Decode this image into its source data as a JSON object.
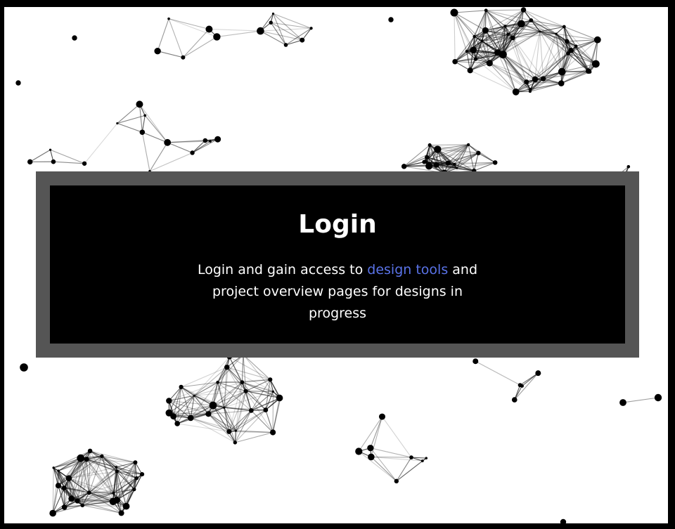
{
  "login": {
    "title": "Login",
    "description_before": "Login and gain access to ",
    "link_text": "design tools",
    "description_after": " and project overview pages for designs in progress"
  },
  "colors": {
    "background": "#ffffff",
    "frame": "#000000",
    "card_border": "#555555",
    "card": "#000000",
    "text": "#ffffff",
    "link": "#5a73e8"
  },
  "decor": {
    "background_icon": "node-network-icon"
  }
}
